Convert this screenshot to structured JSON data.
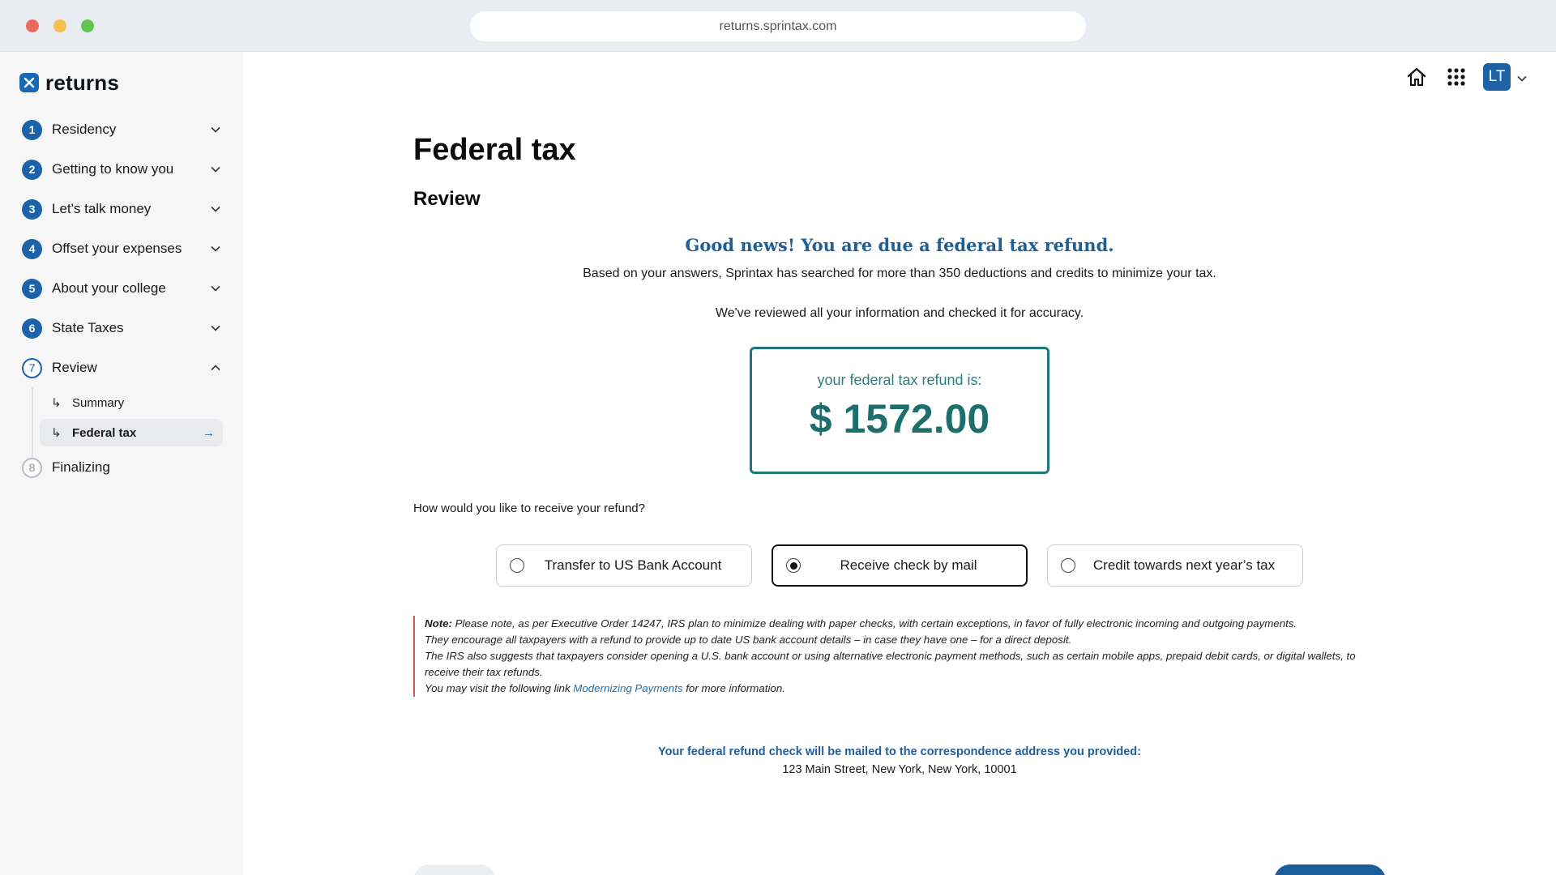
{
  "browser": {
    "url": "returns.sprintax.com"
  },
  "app": {
    "logo_text": "returns",
    "logo_icon": "x-logo-icon"
  },
  "sidebar": {
    "steps": [
      {
        "num": "1",
        "label": "Residency",
        "state": "done",
        "expanded": false
      },
      {
        "num": "2",
        "label": "Getting to know you",
        "state": "done",
        "expanded": false
      },
      {
        "num": "3",
        "label": "Let's talk money",
        "state": "done",
        "expanded": false
      },
      {
        "num": "4",
        "label": "Offset your expenses",
        "state": "done",
        "expanded": false
      },
      {
        "num": "5",
        "label": "About your college",
        "state": "done",
        "expanded": false
      },
      {
        "num": "6",
        "label": "State Taxes",
        "state": "done",
        "expanded": false
      },
      {
        "num": "7",
        "label": "Review",
        "state": "current",
        "expanded": true
      },
      {
        "num": "8",
        "label": "Finalizing",
        "state": "upcoming",
        "expanded": false
      }
    ],
    "substeps": [
      {
        "label": "Summary",
        "active": false
      },
      {
        "label": "Federal tax",
        "active": true
      }
    ]
  },
  "header": {
    "icons": [
      "home-icon",
      "apps-grid-icon"
    ],
    "avatar_initials": "LT"
  },
  "main": {
    "title": "Federal tax",
    "section": "Review",
    "good_news": "Good news! You are due a federal tax refund.",
    "lead_1": "Based on your answers, Sprintax has searched for more than 350 deductions and credits to minimize your tax.",
    "lead_2": "We've reviewed all your information and checked it for accuracy.",
    "refund": {
      "label": "your federal tax refund is:",
      "amount": "$ 1572.00"
    },
    "question": "How would you like to receive your refund?",
    "options": [
      {
        "label": "Transfer to US Bank Account",
        "selected": false
      },
      {
        "label": "Receive check by mail",
        "selected": true
      },
      {
        "label": "Credit towards next year’s tax",
        "selected": false
      }
    ],
    "note": {
      "label": "Note:",
      "line_1": " Please note, as per Executive Order 14247, IRS plan to minimize dealing with paper checks, with certain exceptions, in favor of fully electronic incoming and outgoing payments.",
      "line_2": "They encourage all taxpayers with a refund to provide up to date US bank account details – in case they have one – for a direct deposit.",
      "line_3": "The IRS also suggests that taxpayers consider opening a U.S. bank account or using alternative electronic payment methods, such as certain mobile apps, prepaid debit cards, or digital wallets, to receive their tax refunds.",
      "line_4_prefix": "You may visit the following link ",
      "link_text": "Modernizing Payments",
      "line_4_suffix": " for more information."
    },
    "mail": {
      "heading": "Your federal refund check will be mailed to the correspondence address you provided:",
      "address": "123 Main Street, New York, New York, 10001"
    }
  },
  "colors": {
    "brand_blue": "#1b62a9",
    "refund_teal": "#1e7a7a",
    "note_border": "#d9534f"
  }
}
